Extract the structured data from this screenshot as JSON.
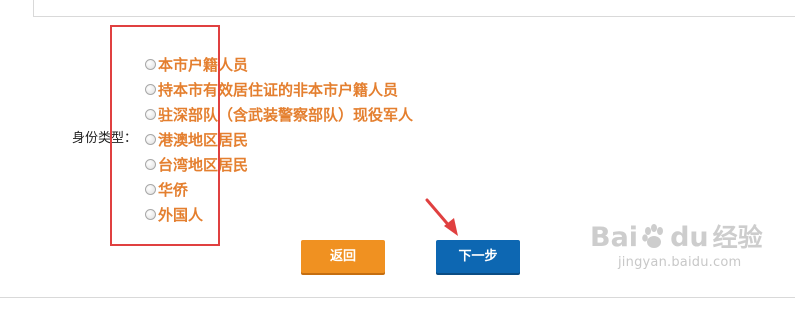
{
  "form": {
    "identity_label": "身份类型：",
    "options": [
      {
        "label": "本市户籍人员",
        "selected": false
      },
      {
        "label": "持本市有效居住证的非本市户籍人员",
        "selected": false
      },
      {
        "label": "驻深部队（含武装警察部队）现役军人",
        "selected": false
      },
      {
        "label": "港澳地区居民",
        "selected": false
      },
      {
        "label": "台湾地区居民",
        "selected": false
      },
      {
        "label": "华侨",
        "selected": false
      },
      {
        "label": "外国人",
        "selected": false
      }
    ],
    "option_text_color": "#e47f2f"
  },
  "buttons": {
    "back_label": "返回",
    "back_color": "#f09121",
    "next_label": "下一步",
    "next_color": "#0d67b2"
  },
  "annotations": {
    "highlight_box_color": "#e04040",
    "arrow_color": "#e04040"
  },
  "watermark": {
    "brand_bai": "Bai",
    "brand_du": "du",
    "product": "经验",
    "url": "jingyan.baidu.com"
  }
}
